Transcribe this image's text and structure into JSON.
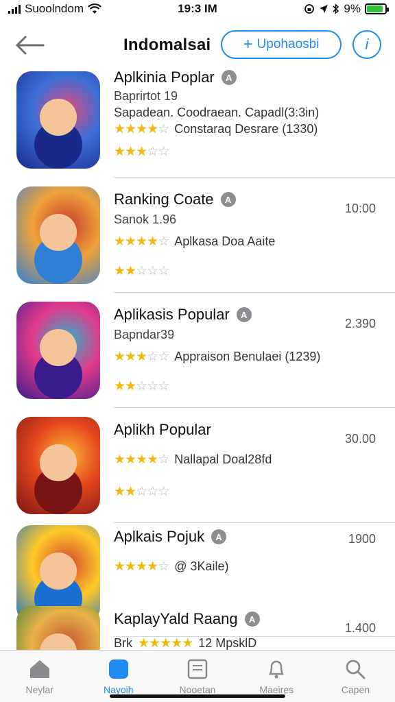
{
  "status_bar": {
    "carrier": "Suoolndom",
    "time": "19:3 IM",
    "battery": "9%",
    "battery_level": 0.9
  },
  "header": {
    "title": "Indomalsai",
    "update_label": "Upohaosbi"
  },
  "apps": [
    {
      "title": "Aplkinia Poplar",
      "sub": "Baprirtot 19",
      "line1": "Sapadean. Coodraean. Capadl(3:3in)",
      "line1_stars": 4.5,
      "line2_text": "Constaraq Desrare (1330)",
      "rating_stars": 3,
      "meta": "",
      "colors": [
        "#1a2a8a",
        "#3b6fd8",
        "#e54a7a"
      ]
    },
    {
      "title": "Ranking Coate",
      "sub": "Sanok 1.96",
      "line1_stars": 4.5,
      "line2_text": "Aplkasa Doa Aaite",
      "rating_stars": 2.5,
      "meta": "10:00",
      "colors": [
        "#2f7fd6",
        "#f0a23a",
        "#c33b2e"
      ]
    },
    {
      "title": "Aplikasis Popular",
      "sub": "Bapndar39",
      "line1_stars": 3.5,
      "line2_text": "Appraison Benulaei (1239)",
      "rating_stars": 2.5,
      "meta": "2.390",
      "colors": [
        "#3a1c8c",
        "#e23a8c",
        "#27b5c9"
      ]
    },
    {
      "title": "Aplikh Popular",
      "sub": "",
      "line1_stars": 4,
      "line2_text": "Nallapal Doal28fd",
      "rating_stars": 2.5,
      "meta": "30.00",
      "colors": [
        "#7a1414",
        "#e3461e",
        "#ffb634"
      ]
    },
    {
      "title": "Aplkais Pojuk",
      "sub": "",
      "line1_stars": 4.5,
      "line2_text": "@ 3Kaile)",
      "rating_stars": 0,
      "meta": "1900",
      "colors": [
        "#1a6fd0",
        "#ffc928",
        "#d2442d"
      ]
    },
    {
      "title": "KaplayYald Raang",
      "sub": "",
      "line1_prefix": "Brk",
      "line1_stars": 5,
      "line2_text": "12 MpsklD",
      "rating_stars": 0,
      "meta": "1.400",
      "colors": [
        "#217a2e",
        "#e8b24a",
        "#c2552c"
      ]
    }
  ],
  "tabs": [
    {
      "label": "Neylar",
      "icon": "home-icon",
      "active": false
    },
    {
      "label": "Nayoih",
      "icon": "apps-icon",
      "active": true
    },
    {
      "label": "Nooetan",
      "icon": "document-icon",
      "active": false
    },
    {
      "label": "Maeires",
      "icon": "bell-icon",
      "active": false
    },
    {
      "label": "Capen",
      "icon": "search-icon",
      "active": false
    }
  ],
  "accent": "#1e8cf0"
}
